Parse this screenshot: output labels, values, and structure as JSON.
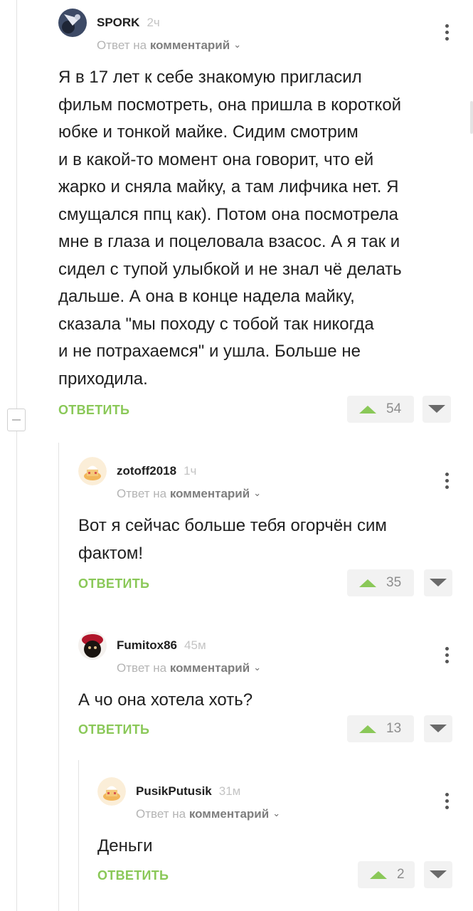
{
  "comments": [
    {
      "author": "SPORK",
      "time": "2ч",
      "reply_prefix": "Ответ на",
      "reply_target": "комментарий",
      "text": "Я в 17 лет к себе знакомую пригласил\nфильм посмотреть, она пришла в короткой\nюбке и тонкой майке. Сидим смотрим\nи в какой-то момент она говорит, что ей\nжарко и сняла майку, а там лифчика нет. Я\nсмущался ппц как). Потом она посмотрела\nмне в глаза и поцеловала взасос. А я так и\nсидел с тупой улыбкой и не знал чё делать\nдальше. А она в конце надела майку,\nсказала \"мы походу с тобой так никогда\nи не потрахаемся\" и ушла. Больше не\nприходила.",
      "reply_label": "ОТВЕТИТЬ",
      "rating": "54"
    },
    {
      "author": "zotoff2018",
      "time": "1ч",
      "reply_prefix": "Ответ на",
      "reply_target": "комментарий",
      "text": "Вот я сейчас больше тебя огорчён сим\nфактом!",
      "reply_label": "ОТВЕТИТЬ",
      "rating": "35"
    },
    {
      "author": "Fumitox86",
      "time": "45м",
      "reply_prefix": "Ответ на",
      "reply_target": "комментарий",
      "text": "А чо она хотела хоть?",
      "reply_label": "ОТВЕТИТЬ",
      "rating": "13"
    },
    {
      "author": "PusikPutusik",
      "time": "31м",
      "reply_prefix": "Ответ на",
      "reply_target": "комментарий",
      "text": "Деньги",
      "reply_label": "ОТВЕТИТЬ",
      "rating": "2"
    }
  ],
  "colors": {
    "accent_green": "#8ac858",
    "muted_text": "#b4b4b4",
    "thread_line": "#e2e2e2"
  },
  "icons": {
    "collapse": "minus-icon",
    "more": "more-vertical-icon",
    "upvote": "triangle-up-icon",
    "downvote": "triangle-down-icon",
    "reply_chevron": "chevron-down-icon"
  }
}
